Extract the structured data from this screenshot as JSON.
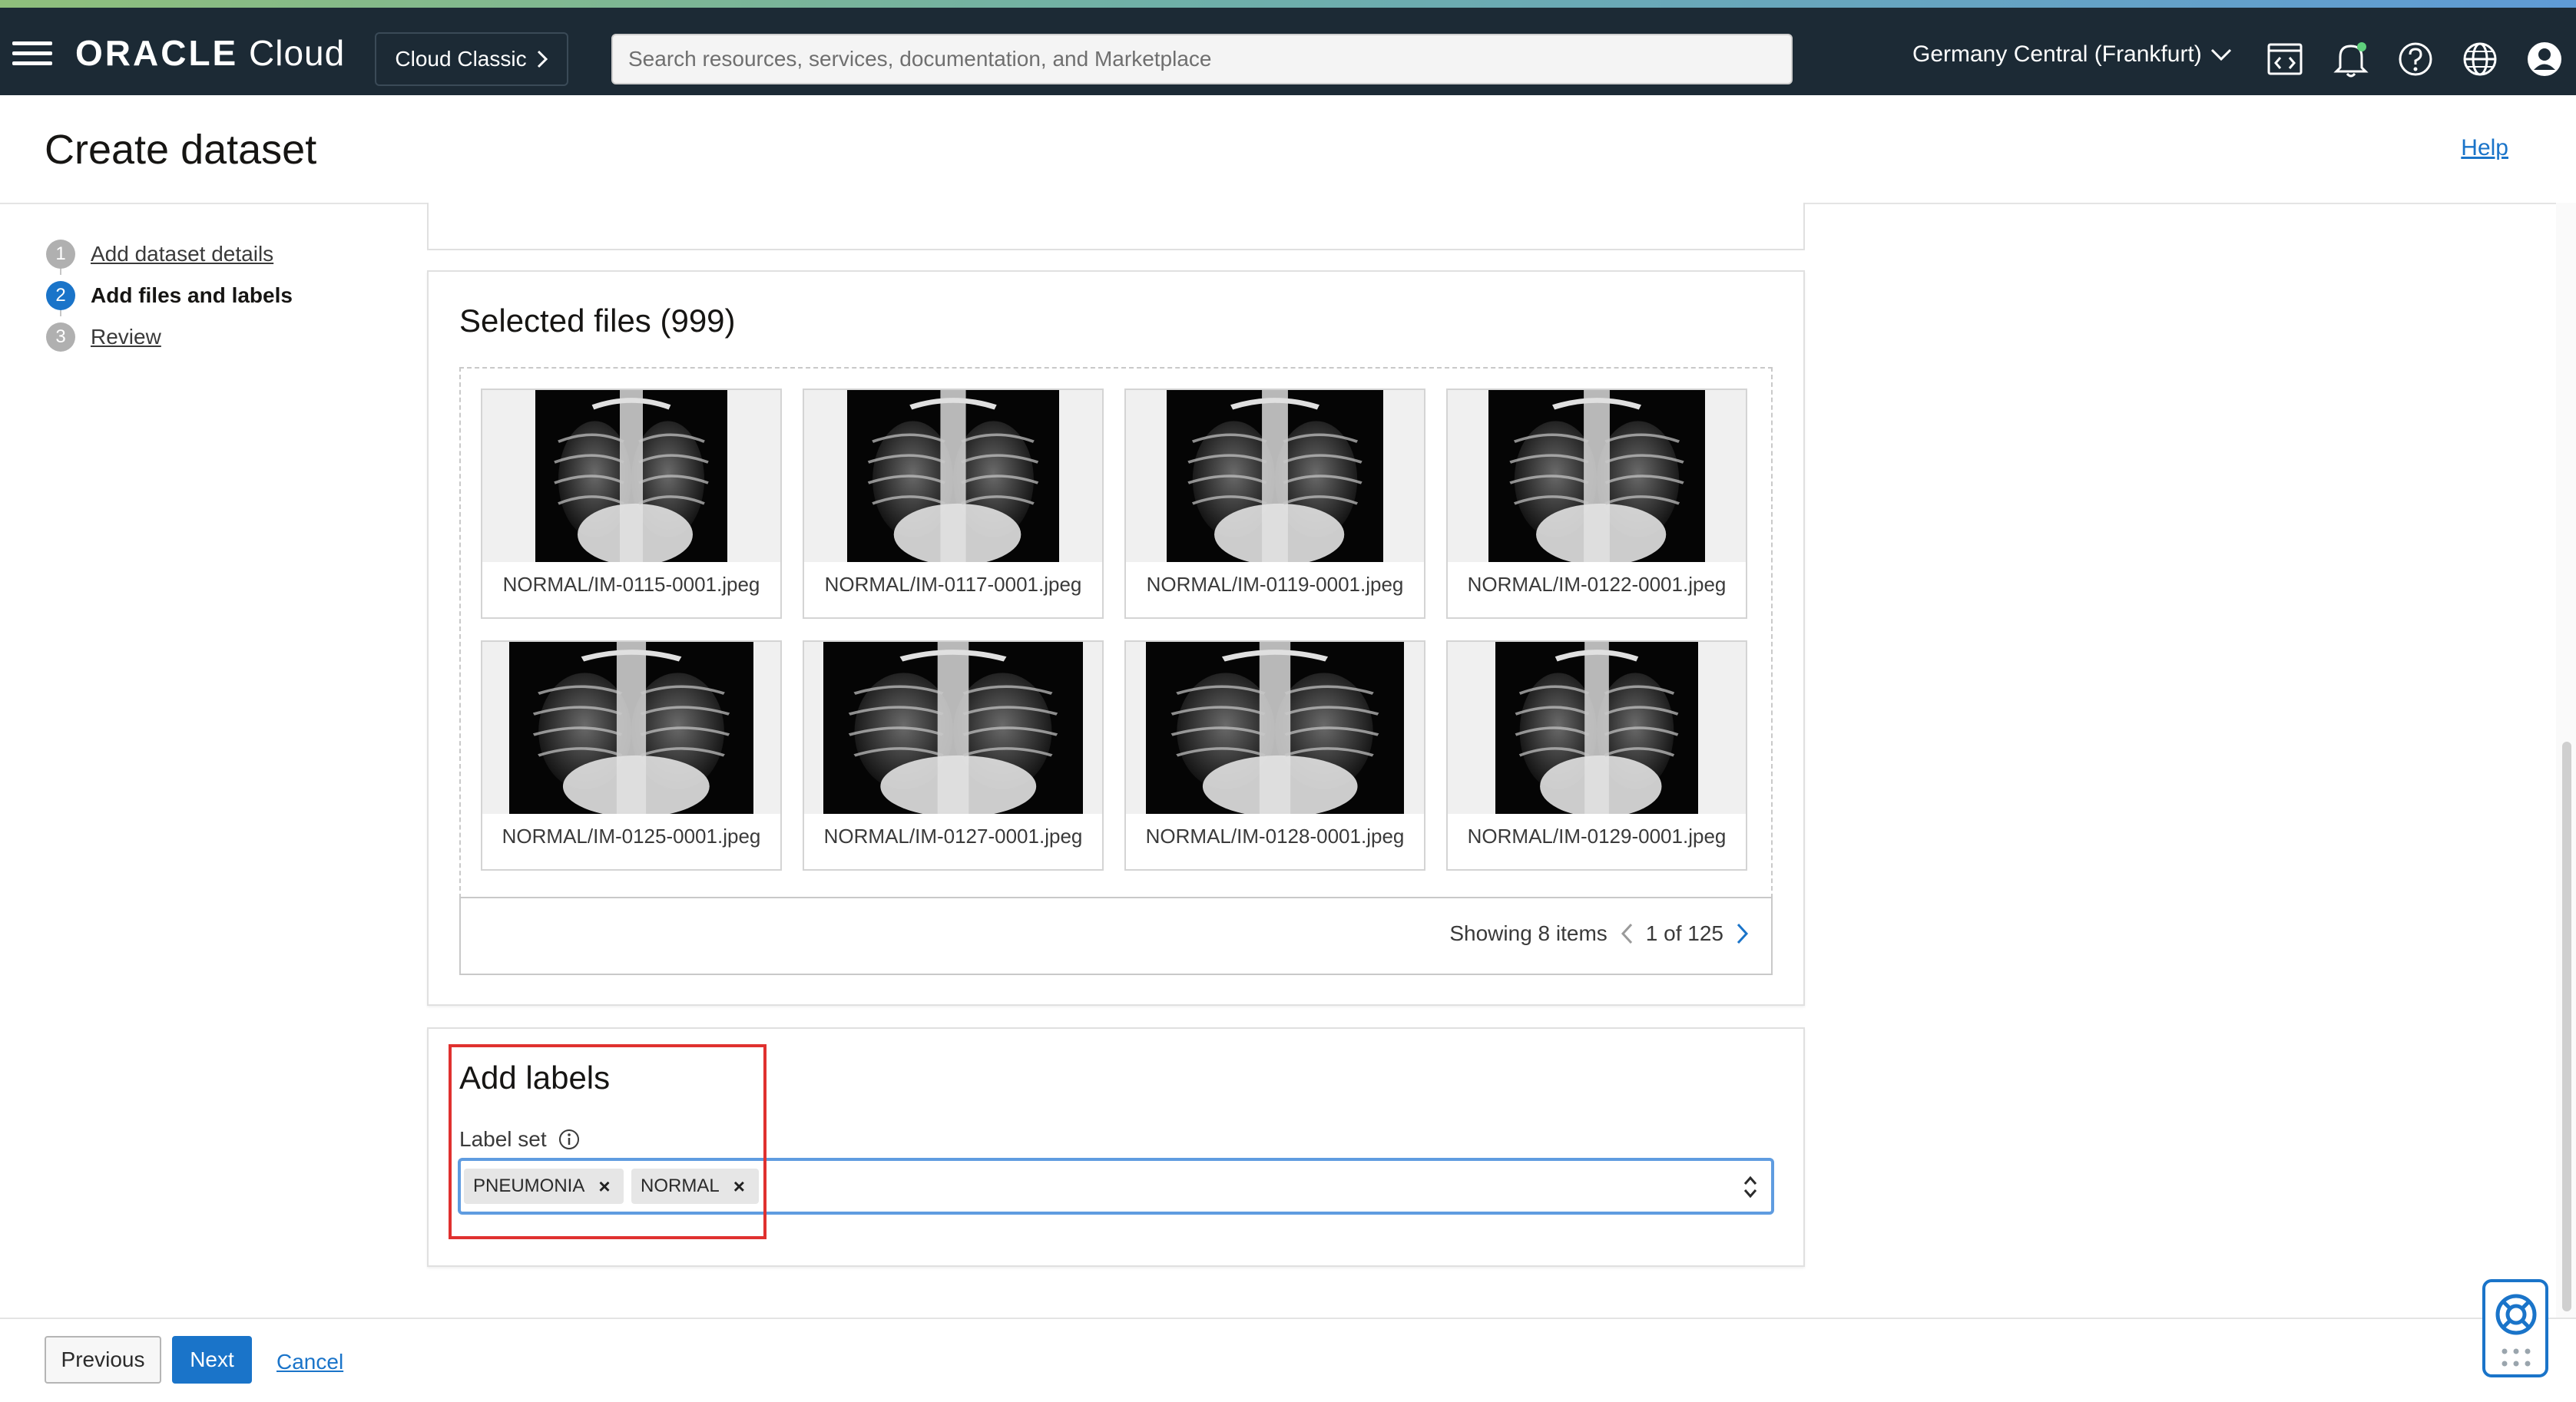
{
  "header": {
    "brand_bold": "ORACLE",
    "brand_light": "Cloud",
    "classic_label": "Cloud Classic",
    "search_placeholder": "Search resources, services, documentation, and Marketplace",
    "region": "Germany Central (Frankfurt)",
    "icons": [
      "menu-icon",
      "code-editor-icon",
      "bell-icon",
      "help-icon",
      "globe-icon",
      "user-icon"
    ]
  },
  "page": {
    "title": "Create dataset",
    "help": "Help"
  },
  "steps": [
    {
      "num": "1",
      "label": "Add dataset details",
      "state": "done"
    },
    {
      "num": "2",
      "label": "Add files and labels",
      "state": "active"
    },
    {
      "num": "3",
      "label": "Review",
      "state": "todo"
    }
  ],
  "files": {
    "title": "Selected files (999)",
    "items": [
      "NORMAL/IM-0115-0001.jpeg",
      "NORMAL/IM-0117-0001.jpeg",
      "NORMAL/IM-0119-0001.jpeg",
      "NORMAL/IM-0122-0001.jpeg",
      "NORMAL/IM-0125-0001.jpeg",
      "NORMAL/IM-0127-0001.jpeg",
      "NORMAL/IM-0128-0001.jpeg",
      "NORMAL/IM-0129-0001.jpeg"
    ],
    "showing": "Showing 8 items",
    "page_of": "1 of 125"
  },
  "labels": {
    "title": "Add labels",
    "caption": "Label set",
    "chips": [
      "PNEUMONIA",
      "NORMAL"
    ]
  },
  "footer": {
    "previous": "Previous",
    "next": "Next",
    "cancel": "Cancel"
  },
  "colors": {
    "accent": "#1a74c9",
    "header_bg": "#1c2a35",
    "highlight": "#e0312f"
  }
}
